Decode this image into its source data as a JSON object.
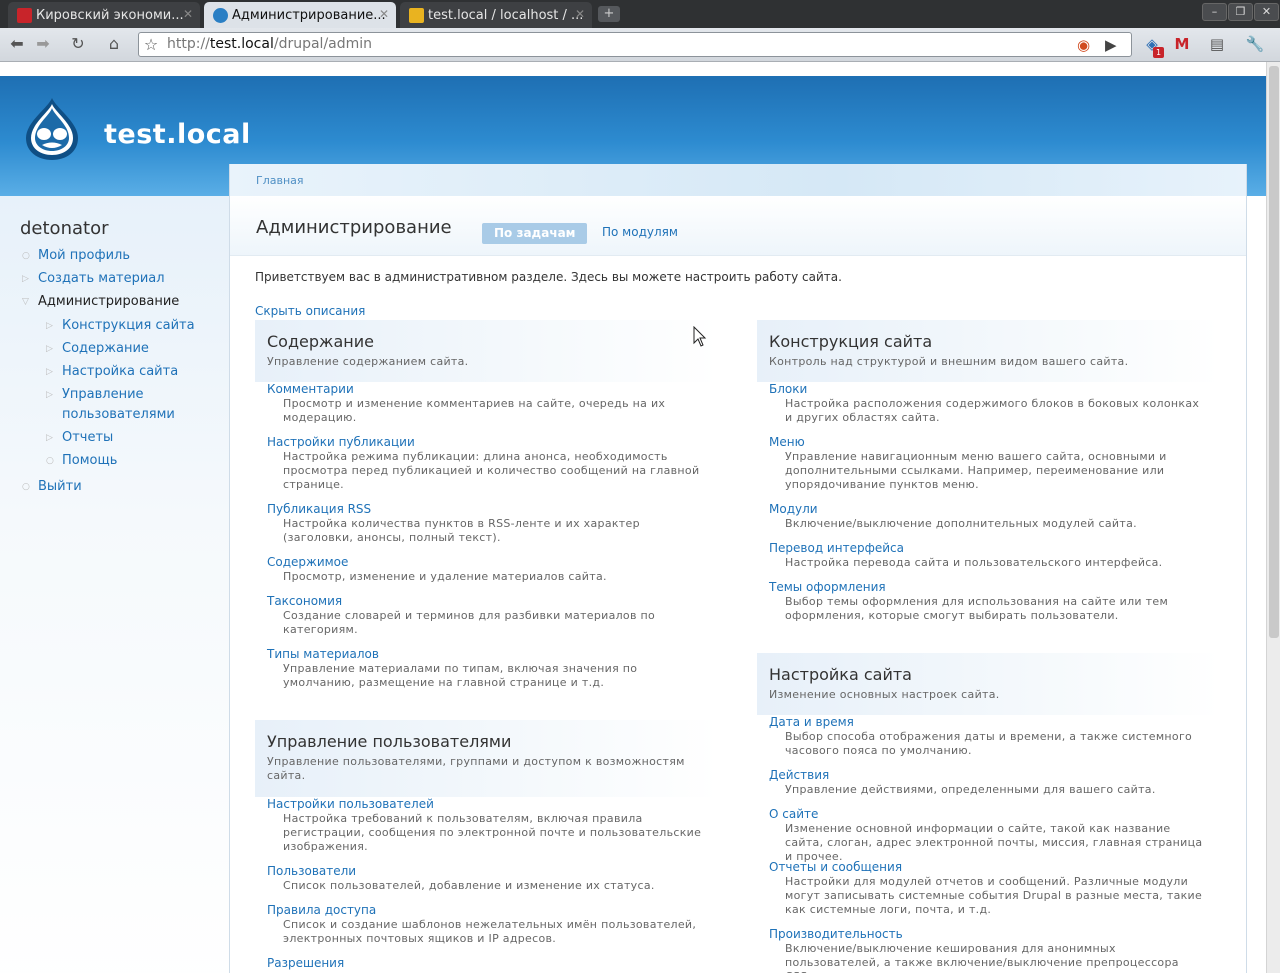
{
  "browser": {
    "tabs": [
      {
        "title": "Кировский экономи...",
        "favicon_color": "#c8242a"
      },
      {
        "title": "Администрирование...",
        "favicon_color": "#2a7fc4"
      },
      {
        "title": "test.local / localhost / ...",
        "favicon_color": "#e9b320"
      }
    ],
    "url_prefix": "http://",
    "url_host": "test.local",
    "url_path": "/drupal/admin",
    "gmail_badge": "1"
  },
  "site": {
    "name": "test.local"
  },
  "sidebar": {
    "username": "detonator",
    "items": [
      {
        "label": "Мой профиль"
      },
      {
        "label": "Создать материал"
      },
      {
        "label": "Администрирование"
      },
      {
        "label": "Конструкция сайта"
      },
      {
        "label": "Содержание"
      },
      {
        "label": "Настройка сайта"
      },
      {
        "label": "Управление",
        "label2": "пользователями"
      },
      {
        "label": "Отчеты"
      },
      {
        "label": "Помощь"
      },
      {
        "label": "Выйти"
      }
    ]
  },
  "main": {
    "breadcrumb": "Главная",
    "title": "Администрирование",
    "tab_active": "По задачам",
    "tab_other": "По модулям",
    "welcome": "Приветствуем вас в административном разделе. Здесь вы можете настроить работу сайта.",
    "hide_descriptions": "Скрыть описания"
  },
  "blocks": {
    "content": {
      "title": "Содержание",
      "desc": "Управление содержанием сайта.",
      "items": [
        {
          "link": "Комментарии",
          "desc": "Просмотр и изменение комментариев на сайте, очередь на их модерацию."
        },
        {
          "link": "Настройки публикации",
          "desc": "Настройка режима публикации: длина анонса, необходимость просмотра перед публикацией и количество сообщений на главной странице."
        },
        {
          "link": "Публикация RSS",
          "desc": "Настройка количества пунктов в RSS-ленте и их характер (заголовки, анонсы, полный текст)."
        },
        {
          "link": "Содержимое",
          "desc": "Просмотр, изменение и удаление материалов сайта."
        },
        {
          "link": "Таксономия",
          "desc": "Создание словарей и терминов для разбивки материалов по категориям."
        },
        {
          "link": "Типы материалов",
          "desc": "Управление материалами по типам, включая значения по умолчанию, размещение на главной странице и т.д."
        }
      ]
    },
    "users": {
      "title": "Управление пользователями",
      "desc": "Управление пользователями, группами и доступом к возможностям сайта.",
      "items": [
        {
          "link": "Настройки пользователей",
          "desc": "Настройка требований к пользователям, включая правила регистрации, сообщения по электронной почте и пользовательские изображения."
        },
        {
          "link": "Пользователи",
          "desc": "Список пользователей, добавление и изменение их статуса."
        },
        {
          "link": "Правила доступа",
          "desc": "Список и создание шаблонов нежелательных имён пользователей, электронных почтовых ящиков и IP адресов."
        },
        {
          "link": "Разрешения",
          "desc": ""
        }
      ]
    },
    "construction": {
      "title": "Конструкция сайта",
      "desc": "Контроль над структурой и внешним видом вашего сайта.",
      "items": [
        {
          "link": "Блоки",
          "desc": "Настройка расположения содержимого блоков в боковых колонках и других областях сайта."
        },
        {
          "link": "Меню",
          "desc": "Управление навигационным меню вашего сайта, основными и дополнительными ссылками. Например, переименование или упорядочивание пунктов меню."
        },
        {
          "link": "Модули",
          "desc": "Включение/выключение дополнительных модулей сайта."
        },
        {
          "link": "Перевод интерфейса",
          "desc": "Настройка перевода сайта и пользовательского интерфейса."
        },
        {
          "link": "Темы оформления",
          "desc": "Выбор темы оформления для использования на сайте или тем оформления, которые смогут выбирать пользователи."
        }
      ]
    },
    "settings": {
      "title": "Настройка сайта",
      "desc": "Изменение основных настроек сайта.",
      "items": [
        {
          "link": "Дата и время",
          "desc": "Выбор способа отображения даты и времени, а также системного часового пояса по умолчанию."
        },
        {
          "link": "Действия",
          "desc": "Управление действиями, определенными для вашего сайта."
        },
        {
          "link": "О сайте",
          "desc": "Изменение основной информации о сайте, такой как название сайта, слоган, адрес электронной почты, миссия, главная страница и прочее."
        },
        {
          "link": "Отчеты и сообщения",
          "desc": "Настройки для модулей отчетов и сообщений. Различные модули могут записывать системные события Drupal в разные места, такие как системные логи, почта, и т.д."
        },
        {
          "link": "Производительность",
          "desc": "Включение/выключение кеширования для анонимных пользователей, а также включение/выключение препроцессора CSS."
        }
      ]
    }
  }
}
